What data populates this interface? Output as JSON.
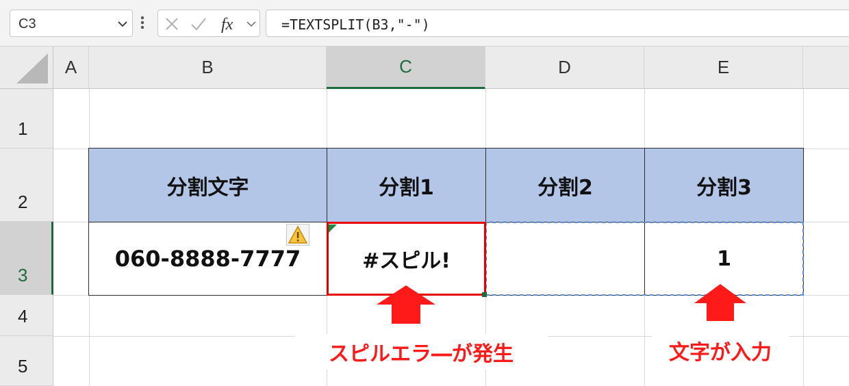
{
  "formula_bar": {
    "name_box": "C3",
    "formula": "=TEXTSPLIT(B3,\"-\")"
  },
  "columns": [
    "A",
    "B",
    "C",
    "D",
    "E"
  ],
  "rows": [
    "1",
    "2",
    "3",
    "4",
    "5"
  ],
  "selected_cell": {
    "column": "C",
    "row": "3"
  },
  "table": {
    "headers": [
      "分割文字",
      "分割1",
      "分割2",
      "分割3"
    ],
    "row3": {
      "B": "060-8888-7777",
      "C": "#スピル!",
      "D": "",
      "E": "1"
    }
  },
  "annotations": {
    "spill_error": "スピルエラ―が発生",
    "text_entered": "文字が入力"
  },
  "colors": {
    "header_fill": "#b4c6e7",
    "annotation_red": "#ff1a1a",
    "selection_green": "#1d6b3d",
    "spill_border_blue": "#5b8dd6"
  }
}
